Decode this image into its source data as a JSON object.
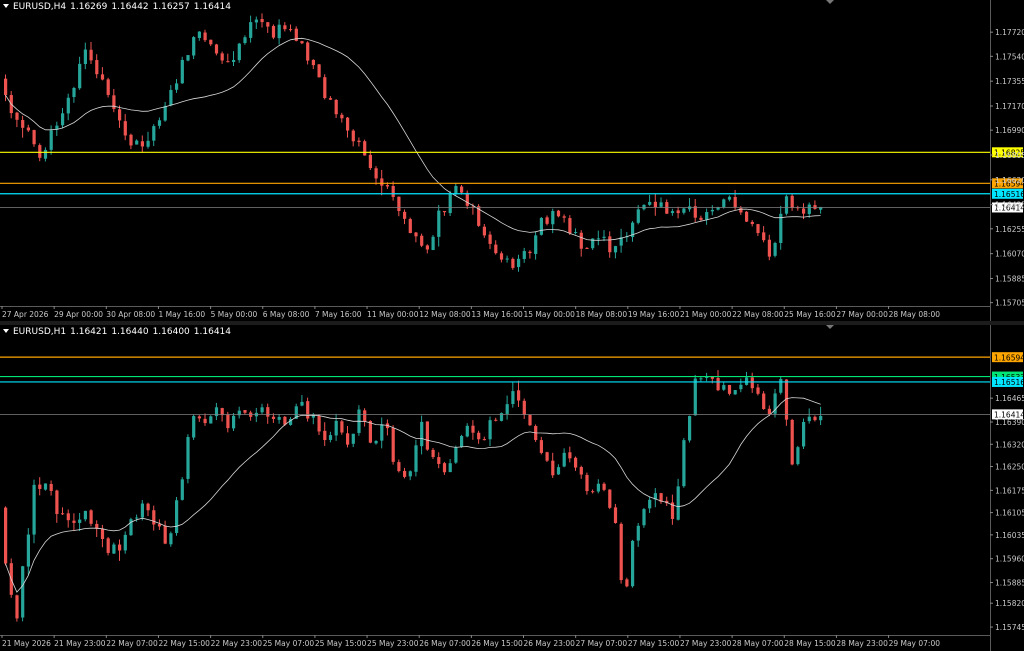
{
  "colors": {
    "bull": "#26a69a",
    "bear": "#ef5350",
    "ma": "#d8d8d8",
    "yellow": "#ffff00",
    "orange": "#ffa500",
    "cyan": "#00e5ff",
    "green": "#00e676",
    "current": "#808080",
    "axis_text": "#c8c8c8"
  },
  "chart_data": [
    {
      "type": "candlestick",
      "symbol": "EURUSD,H4",
      "ohlc_header": [
        "1.16269",
        "1.16442",
        "1.16257",
        "1.16414"
      ],
      "x_tick_labels": [
        "27 Apr 2026",
        "29 Apr 00:00",
        "30 Apr 08:00",
        "1 May 16:00",
        "5 May 00:00",
        "6 May 08:00",
        "7 May 16:00",
        "11 May 00:00",
        "12 May 08:00",
        "13 May 16:00",
        "15 May 00:00",
        "18 May 08:00",
        "19 May 16:00",
        "21 May 00:00",
        "22 May 08:00",
        "25 May 16:00",
        "27 May 00:00",
        "28 May 08:00"
      ],
      "y_tick_labels": [
        "1.17720",
        "1.17540",
        "1.17355",
        "1.17170",
        "1.16990",
        "1.16805",
        "1.16620",
        "1.16435",
        "1.16255",
        "1.16070",
        "1.15885",
        "1.15705"
      ],
      "y_ticks": [
        1.1772,
        1.1754,
        1.17355,
        1.1717,
        1.1699,
        1.16805,
        1.1662,
        1.16435,
        1.16255,
        1.1607,
        1.15885,
        1.15705
      ],
      "ylim": [
        1.1568,
        1.179
      ],
      "bars": 144,
      "anchors": [
        [
          0,
          1.1738
        ],
        [
          6,
          1.1712
        ],
        [
          12,
          1.1695
        ],
        [
          18,
          1.1678
        ],
        [
          24,
          1.1705
        ],
        [
          30,
          1.1728
        ],
        [
          36,
          1.1762
        ],
        [
          42,
          1.1735
        ],
        [
          48,
          1.1718
        ],
        [
          54,
          1.169
        ],
        [
          60,
          1.1688
        ],
        [
          66,
          1.1702
        ],
        [
          72,
          1.1728
        ],
        [
          78,
          1.1755
        ],
        [
          84,
          1.1772
        ],
        [
          90,
          1.176
        ],
        [
          96,
          1.1748
        ],
        [
          102,
          1.1765
        ],
        [
          108,
          1.1783
        ],
        [
          114,
          1.1771
        ],
        [
          120,
          1.1777
        ],
        [
          126,
          1.1765
        ],
        [
          132,
          1.1745
        ],
        [
          138,
          1.172
        ],
        [
          144,
          1.1705
        ],
        [
          150,
          1.1692
        ],
        [
          156,
          1.167
        ],
        [
          162,
          1.1658
        ],
        [
          168,
          1.1638
        ],
        [
          174,
          1.162
        ],
        [
          180,
          1.1612
        ],
        [
          186,
          1.164
        ],
        [
          192,
          1.1655
        ],
        [
          198,
          1.1642
        ],
        [
          204,
          1.162
        ],
        [
          210,
          1.1605
        ],
        [
          216,
          1.1598
        ],
        [
          222,
          1.161
        ],
        [
          228,
          1.163
        ],
        [
          234,
          1.1636
        ],
        [
          240,
          1.1625
        ],
        [
          246,
          1.1612
        ],
        [
          252,
          1.162
        ],
        [
          258,
          1.161
        ],
        [
          264,
          1.1622
        ],
        [
          270,
          1.164
        ],
        [
          276,
          1.1644
        ],
        [
          282,
          1.1638
        ],
        [
          288,
          1.1642
        ],
        [
          294,
          1.1632
        ],
        [
          300,
          1.164
        ],
        [
          306,
          1.1648
        ],
        [
          312,
          1.1635
        ],
        [
          318,
          1.1624
        ],
        [
          324,
          1.1603
        ],
        [
          330,
          1.1648
        ],
        [
          336,
          1.164
        ],
        [
          342,
          1.1641
        ]
      ],
      "x_range": [
        0,
        345
      ],
      "levels": [
        {
          "label": "1.16825",
          "price": 1.16825,
          "color": "#ffff00"
        },
        {
          "label": "1.16594",
          "price": 1.16594,
          "color": "#ffa500"
        },
        {
          "label": "1.16516",
          "price": 1.16516,
          "color": "#00e5ff"
        },
        {
          "label": "1.16414",
          "price": 1.16414,
          "color": "#808080",
          "current": true
        }
      ]
    },
    {
      "type": "candlestick",
      "symbol": "EURUSD,H1",
      "ohlc_header": [
        "1.16421",
        "1.16440",
        "1.16400",
        "1.16414"
      ],
      "x_tick_labels": [
        "21 May 2026",
        "21 May 23:00",
        "22 May 07:00",
        "22 May 15:00",
        "22 May 23:00",
        "25 May 07:00",
        "25 May 15:00",
        "25 May 23:00",
        "26 May 07:00",
        "26 May 15:00",
        "26 May 23:00",
        "27 May 07:00",
        "27 May 15:00",
        "27 May 23:00",
        "28 May 07:00",
        "28 May 15:00",
        "28 May 23:00",
        "29 May 07:00"
      ],
      "y_tick_labels": [
        "1.16465",
        "1.16390",
        "1.16320",
        "1.16250",
        "1.16175",
        "1.16105",
        "1.16035",
        "1.15960",
        "1.15885",
        "1.15820",
        "1.15745"
      ],
      "y_ticks": [
        1.16465,
        1.1639,
        1.1632,
        1.1625,
        1.16175,
        1.16105,
        1.16035,
        1.1596,
        1.15885,
        1.1582,
        1.15745
      ],
      "ylim": [
        1.1572,
        1.1667
      ],
      "bars": 144,
      "anchors": [
        [
          0,
          1.1612
        ],
        [
          4,
          1.159
        ],
        [
          8,
          1.1578
        ],
        [
          12,
          1.1595
        ],
        [
          18,
          1.162
        ],
        [
          24,
          1.1618
        ],
        [
          30,
          1.161
        ],
        [
          36,
          1.1608
        ],
        [
          42,
          1.161
        ],
        [
          48,
          1.1606
        ],
        [
          54,
          1.1598
        ],
        [
          60,
          1.16
        ],
        [
          66,
          1.1608
        ],
        [
          72,
          1.1612
        ],
        [
          78,
          1.1606
        ],
        [
          84,
          1.16
        ],
        [
          90,
          1.162
        ],
        [
          96,
          1.164
        ],
        [
          102,
          1.1638
        ],
        [
          108,
          1.1642
        ],
        [
          114,
          1.1638
        ],
        [
          120,
          1.1641
        ],
        [
          126,
          1.164
        ],
        [
          132,
          1.1643
        ],
        [
          138,
          1.164
        ],
        [
          144,
          1.1638
        ],
        [
          150,
          1.1644
        ],
        [
          156,
          1.164
        ],
        [
          162,
          1.1634
        ],
        [
          168,
          1.1638
        ],
        [
          174,
          1.1632
        ],
        [
          180,
          1.1642
        ],
        [
          186,
          1.1632
        ],
        [
          192,
          1.1638
        ],
        [
          198,
          1.1625
        ],
        [
          204,
          1.1622
        ],
        [
          210,
          1.1638
        ],
        [
          216,
          1.1628
        ],
        [
          222,
          1.1624
        ],
        [
          228,
          1.163
        ],
        [
          234,
          1.1638
        ],
        [
          240,
          1.1633
        ],
        [
          246,
          1.164
        ],
        [
          252,
          1.1644
        ],
        [
          258,
          1.1648
        ],
        [
          264,
          1.1638
        ],
        [
          270,
          1.163
        ],
        [
          276,
          1.1622
        ],
        [
          282,
          1.163
        ],
        [
          288,
          1.1625
        ],
        [
          294,
          1.1618
        ],
        [
          300,
          1.1618
        ],
        [
          306,
          1.161
        ],
        [
          312,
          1.1585
        ],
        [
          318,
          1.1605
        ],
        [
          324,
          1.1615
        ],
        [
          330,
          1.1615
        ],
        [
          336,
          1.161
        ],
        [
          342,
          1.1632
        ],
        [
          348,
          1.1652
        ],
        [
          354,
          1.1655
        ],
        [
          360,
          1.165
        ],
        [
          366,
          1.1648
        ],
        [
          372,
          1.1652
        ],
        [
          378,
          1.1647
        ],
        [
          384,
          1.164
        ],
        [
          390,
          1.1652
        ],
        [
          396,
          1.1625
        ],
        [
          402,
          1.164
        ],
        [
          408,
          1.1641
        ]
      ],
      "x_range": [
        0,
        410
      ],
      "levels": [
        {
          "label": "1.16594",
          "price": 1.16594,
          "color": "#ffa500"
        },
        {
          "label": "1.16533",
          "price": 1.16533,
          "color": "#00e676"
        },
        {
          "label": "1.16516",
          "price": 1.16516,
          "color": "#00e5ff"
        },
        {
          "label": "1.16414",
          "price": 1.16414,
          "color": "#808080",
          "current": true
        }
      ]
    }
  ]
}
